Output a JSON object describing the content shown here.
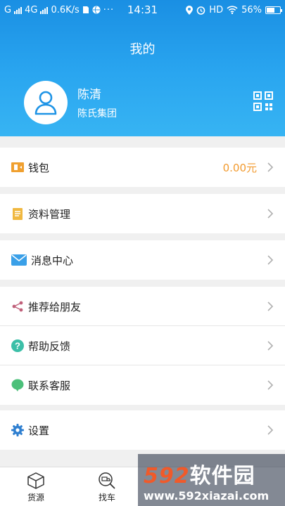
{
  "status_bar": {
    "left_text": "G",
    "network": "4G",
    "speed": "0.6K/s",
    "time": "14:31",
    "hd": "HD",
    "battery": "56%"
  },
  "header": {
    "title": "我的",
    "user_name": "陈清",
    "company": "陈氏集团"
  },
  "menu": {
    "wallet": {
      "label": "钱包",
      "value": "0.00元",
      "icon": "wallet-icon",
      "color": "#f0a030"
    },
    "profile": {
      "label": "资料管理",
      "icon": "document-icon",
      "color": "#f0b840"
    },
    "messages": {
      "label": "消息中心",
      "icon": "envelope-icon",
      "color": "#3aa0e8"
    },
    "share": {
      "label": "推荐给朋友",
      "icon": "share-icon",
      "color": "#c0607a"
    },
    "help": {
      "label": "帮助反馈",
      "icon": "question-icon",
      "color": "#3cbfa8"
    },
    "service": {
      "label": "联系客服",
      "icon": "chat-bubble-icon",
      "color": "#4cc07a"
    },
    "settings": {
      "label": "设置",
      "icon": "gear-icon",
      "color": "#2f7fd0"
    }
  },
  "tabbar": {
    "tabs": [
      {
        "label": "货源",
        "icon": "box-icon"
      },
      {
        "label": "找车",
        "icon": "search-truck-icon"
      }
    ]
  },
  "watermark": {
    "brand_num": "592",
    "brand_text": "软件园",
    "url": "www.592xiazai.com"
  }
}
